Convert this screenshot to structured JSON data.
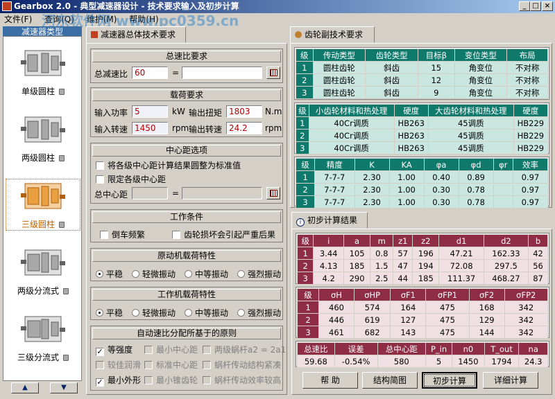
{
  "window": {
    "title": "Gearbox 2.0 - 典型减速器设计 - 技术要求输入及初步计算"
  },
  "menu": [
    "文件(F)",
    "查询(Q)",
    "维护(M)",
    "帮助(H)"
  ],
  "watermark": "河东软件网 www.pc0359.cn",
  "sidebar": {
    "header": "减速器类型",
    "items": [
      {
        "label": "单级圆柱",
        "icon": "gearbox-single-cylindrical-icon"
      },
      {
        "label": "两级圆柱",
        "icon": "gearbox-two-stage-cylindrical-icon"
      },
      {
        "label": "三级圆柱",
        "icon": "gearbox-three-stage-cylindrical-icon",
        "selected": true
      },
      {
        "label": "两级分流式",
        "icon": "gearbox-two-stage-split-icon"
      },
      {
        "label": "三级分流式",
        "icon": "gearbox-three-stage-split-icon"
      }
    ]
  },
  "left_tab": "减速器总体技术要求",
  "ratio": {
    "title": "总速比要求",
    "label": "总减速比",
    "value": "60",
    "eq": "="
  },
  "load": {
    "title": "载荷要求",
    "p_in_label": "输入功率",
    "p_in": "5",
    "p_unit": "kW",
    "t_out_label": "输出扭矩",
    "t_out": "1803",
    "t_unit": "N.m",
    "n_in_label": "输入转速",
    "n_in": "1450",
    "n_in_unit": "rpm",
    "n_out_label": "输出转速",
    "n_out": "24.2",
    "n_out_unit": "rpm"
  },
  "center": {
    "title": "中心距选项",
    "cb1": "将各级中心距计算结果圆整为标准值",
    "cb2": "限定各级中心距",
    "label": "总中心距",
    "eq": "="
  },
  "work": {
    "title": "工作条件",
    "cb1": "倒车频繁",
    "cb2": "齿轮损坏会引起严重后果"
  },
  "prime": {
    "title": "原动机载荷特性",
    "options": [
      "平稳",
      "轻微振动",
      "中等振动",
      "强烈振动"
    ],
    "selected": 0
  },
  "machine": {
    "title": "工作机载荷特性",
    "options": [
      "平稳",
      "轻微振动",
      "中等振动",
      "强烈振动"
    ],
    "selected": 0
  },
  "principle": {
    "title": "自动速比分配所基于的原则",
    "items": [
      {
        "label": "等强度",
        "checked": true,
        "enabled": true
      },
      {
        "label": "最小中心距",
        "checked": false,
        "enabled": false
      },
      {
        "label": "两级蜗杆a2 = 2a1",
        "checked": false,
        "enabled": false
      },
      {
        "label": "较佳润滑",
        "checked": false,
        "enabled": false
      },
      {
        "label": "标准中心距",
        "checked": false,
        "enabled": false
      },
      {
        "label": "蜗杆传动结构紧凑",
        "checked": false,
        "enabled": false
      },
      {
        "label": "最小外形",
        "checked": true,
        "enabled": true
      },
      {
        "label": "最小锥齿轮",
        "checked": false,
        "enabled": false
      },
      {
        "label": "蜗杆传动效率较高",
        "checked": false,
        "enabled": false
      }
    ]
  },
  "right_tab": "齿轮副技术要求",
  "gear_table1": {
    "headers": [
      "级",
      "传动类型",
      "齿轮类型",
      "目标β",
      "变位类型",
      "布局"
    ],
    "rows": [
      [
        "1",
        "圆柱齿轮",
        "斜齿",
        "15",
        "角变位",
        "不对称"
      ],
      [
        "2",
        "圆柱齿轮",
        "斜齿",
        "12",
        "角变位",
        "不对称"
      ],
      [
        "3",
        "圆柱齿轮",
        "斜齿",
        "9",
        "角变位",
        "不对称"
      ]
    ]
  },
  "gear_table2": {
    "headers": [
      "级",
      "小齿轮材料和热处理",
      "硬度",
      "大齿轮材料和热处理",
      "硬度"
    ],
    "rows": [
      [
        "1",
        "40Cr调质",
        "HB263",
        "45调质",
        "HB229"
      ],
      [
        "2",
        "40Cr调质",
        "HB263",
        "45调质",
        "HB229"
      ],
      [
        "3",
        "40Cr调质",
        "HB263",
        "45调质",
        "HB229"
      ]
    ]
  },
  "gear_table3": {
    "headers": [
      "级",
      "精度",
      "K",
      "KA",
      "φa",
      "φd",
      "φr",
      "效率"
    ],
    "rows": [
      [
        "1",
        "7-7-7",
        "2.30",
        "1.00",
        "0.40",
        "0.89",
        "",
        "0.97"
      ],
      [
        "2",
        "7-7-7",
        "2.30",
        "1.00",
        "0.30",
        "0.78",
        "",
        "0.97"
      ],
      [
        "3",
        "7-7-7",
        "2.30",
        "1.00",
        "0.30",
        "0.78",
        "",
        "0.97"
      ]
    ]
  },
  "result_tab": "初步计算结果",
  "res_table1": {
    "headers": [
      "级",
      "i",
      "a",
      "m",
      "z1",
      "z2",
      "d1",
      "d2",
      "b"
    ],
    "rows": [
      [
        "1",
        "3.44",
        "105",
        "0.8",
        "57",
        "196",
        "47.21",
        "162.33",
        "42"
      ],
      [
        "2",
        "4.13",
        "185",
        "1.5",
        "47",
        "194",
        "72.08",
        "297.5",
        "56"
      ],
      [
        "3",
        "4.2",
        "290",
        "2.5",
        "44",
        "185",
        "111.37",
        "468.27",
        "87"
      ]
    ]
  },
  "res_table2": {
    "headers": [
      "级",
      "σH",
      "σHP",
      "σF1",
      "σFP1",
      "σF2",
      "σFP2"
    ],
    "rows": [
      [
        "1",
        "460",
        "574",
        "164",
        "475",
        "168",
        "342"
      ],
      [
        "2",
        "446",
        "619",
        "127",
        "475",
        "129",
        "342"
      ],
      [
        "3",
        "461",
        "682",
        "143",
        "475",
        "144",
        "342"
      ]
    ]
  },
  "res_table3": {
    "headers": [
      "总速比",
      "误差",
      "总中心距",
      "P_in",
      "n0",
      "T_out",
      "na"
    ],
    "rows": [
      [
        "59.68",
        "-0.54%",
        "580",
        "5",
        "1450",
        "1794",
        "24.3"
      ]
    ]
  },
  "buttons": {
    "help": "帮 助",
    "sketch": "结构简图",
    "prelim": "初步计算",
    "detail": "详细计算"
  },
  "colors": {
    "title_start": "#0a246a",
    "teal": "#0f7a6c",
    "maroon": "#8e2d45",
    "selected": "#e8a040"
  }
}
